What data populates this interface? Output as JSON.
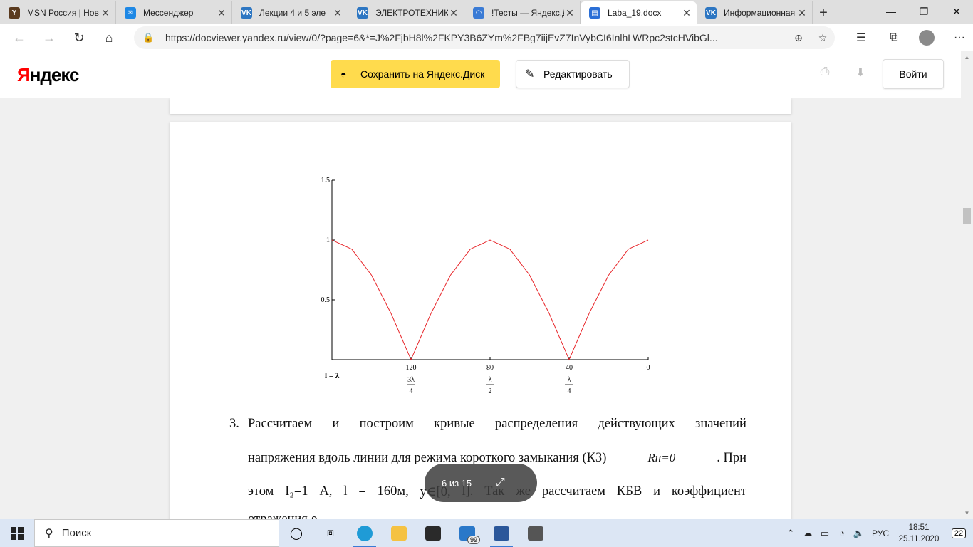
{
  "tabs": [
    {
      "title": "MSN Россия | Нов",
      "color": "#5a3a1e",
      "glyph": "Y"
    },
    {
      "title": "Мессенджер",
      "color": "#1e88e5",
      "glyph": "✉"
    },
    {
      "title": "Лекции 4 и 5 эле",
      "color": "#2d76c2",
      "glyph": "VK"
    },
    {
      "title": "ЭЛЕКТРОТЕХНИКА",
      "color": "#2d76c2",
      "glyph": "VK"
    },
    {
      "title": "!Тесты — Яндекс.Д",
      "color": "#3a7bd5",
      "glyph": "◠"
    },
    {
      "title": "Laba_19.docx",
      "color": "#2b6fd6",
      "glyph": "▤",
      "active": true
    },
    {
      "title": "Информационная",
      "color": "#2d76c2",
      "glyph": "VK"
    }
  ],
  "address_bar": {
    "url": "https://docviewer.yandex.ru/view/0/?page=6&*=J%2FjbH8l%2FKPY3B6ZYm%2FBg7iijEvZ7InVybCI6InlhLWRpc2stcHVibGl..."
  },
  "header": {
    "logo_first": "Я",
    "logo_rest": "ндекс",
    "save_button": "Сохранить на Яндекс.Диск",
    "edit_button": "Редактировать",
    "login_button": "Войти",
    "accent_color": "#ffdb4d"
  },
  "chart_data": {
    "type": "line",
    "series_color": "#e8262a",
    "yticks": [
      "1.5",
      "1",
      "0.5"
    ],
    "ylim": [
      0,
      1.5
    ],
    "xlim": [
      160,
      0
    ],
    "x_label_left": "l = λ",
    "xticks": [
      {
        "value": "120",
        "frac_num": "3λ",
        "frac_den": "4"
      },
      {
        "value": "80",
        "frac_num": "λ",
        "frac_den": "2"
      },
      {
        "value": "40",
        "frac_num": "λ",
        "frac_den": "4"
      },
      {
        "value": "0",
        "frac_num": "",
        "frac_den": ""
      }
    ],
    "series": [
      {
        "x": [
          160,
          150,
          140,
          130,
          120,
          110,
          100,
          90,
          80,
          70,
          60,
          50,
          40,
          30,
          20,
          10,
          0
        ],
        "y": [
          1.0,
          0.924,
          0.707,
          0.383,
          0.0,
          0.383,
          0.707,
          0.924,
          1.0,
          0.924,
          0.707,
          0.383,
          0.0,
          0.383,
          0.707,
          0.924,
          1.0
        ]
      }
    ]
  },
  "document": {
    "item_number": "3.",
    "line1_words": [
      "Рассчитаем",
      "и",
      "построим",
      "кривые",
      "распределения",
      "действующих",
      "значений"
    ],
    "line2_text": "напряжения вдоль линии для режима короткого замыкания (КЗ)",
    "line2_math": "Rн=0",
    "line2_tail": ". При",
    "line3_words": [
      "этом",
      "I₂=1",
      "А,",
      "l",
      "=",
      "160м,",
      "y∈[0,",
      "l].",
      "Так",
      "же",
      "рассчитаем",
      "КБВ",
      "и",
      "коэффициент"
    ],
    "line4_text": "отражения ρ"
  },
  "pager": {
    "count": "6 из 15"
  },
  "taskbar": {
    "search_placeholder": "Поиск",
    "mail_badge": "99",
    "lang": "РУС",
    "time": "18:51",
    "date": "25.11.2020",
    "notifications": "22"
  }
}
